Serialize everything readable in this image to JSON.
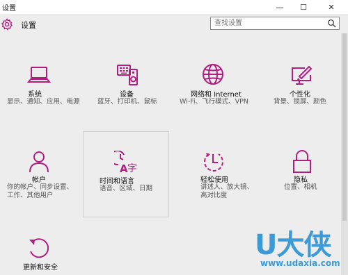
{
  "window": {
    "title": "设置",
    "controls": {
      "minimize": "—",
      "maximize": "☐",
      "close": "✕"
    }
  },
  "header": {
    "title": "设置",
    "icon": "gear-icon"
  },
  "search": {
    "placeholder": "查找设置",
    "icon": "search-icon"
  },
  "accent_color": "#b01f7f",
  "tiles": [
    {
      "name": "系统",
      "desc": "显示、通知、应用、电源",
      "icon": "laptop-icon"
    },
    {
      "name": "设备",
      "desc": "蓝牙、打印机、鼠标",
      "icon": "keyboard-speaker-icon"
    },
    {
      "name": "网络和 Internet",
      "desc": "Wi-Fi、飞行模式、VPN",
      "icon": "globe-icon"
    },
    {
      "name": "个性化",
      "desc": "背景、锁屏、颜色",
      "icon": "paint-monitor-icon"
    },
    {
      "name": "帐户",
      "desc": "你的帐户、同步设置、工作、其他用户",
      "icon": "person-icon"
    },
    {
      "name": "时间和语言",
      "desc": "语音、区域、日期",
      "icon": "time-language-icon"
    },
    {
      "name": "轻松使用",
      "desc": "讲述人、放大镜、高对比度",
      "icon": "ease-of-access-icon"
    },
    {
      "name": "隐私",
      "desc": "位置、相机",
      "icon": "lock-icon"
    },
    {
      "name": "更新和安全",
      "desc": "",
      "icon": "refresh-icon"
    }
  ],
  "watermark": {
    "logo_text": "U大侠",
    "url": "www.udaxia.com"
  }
}
